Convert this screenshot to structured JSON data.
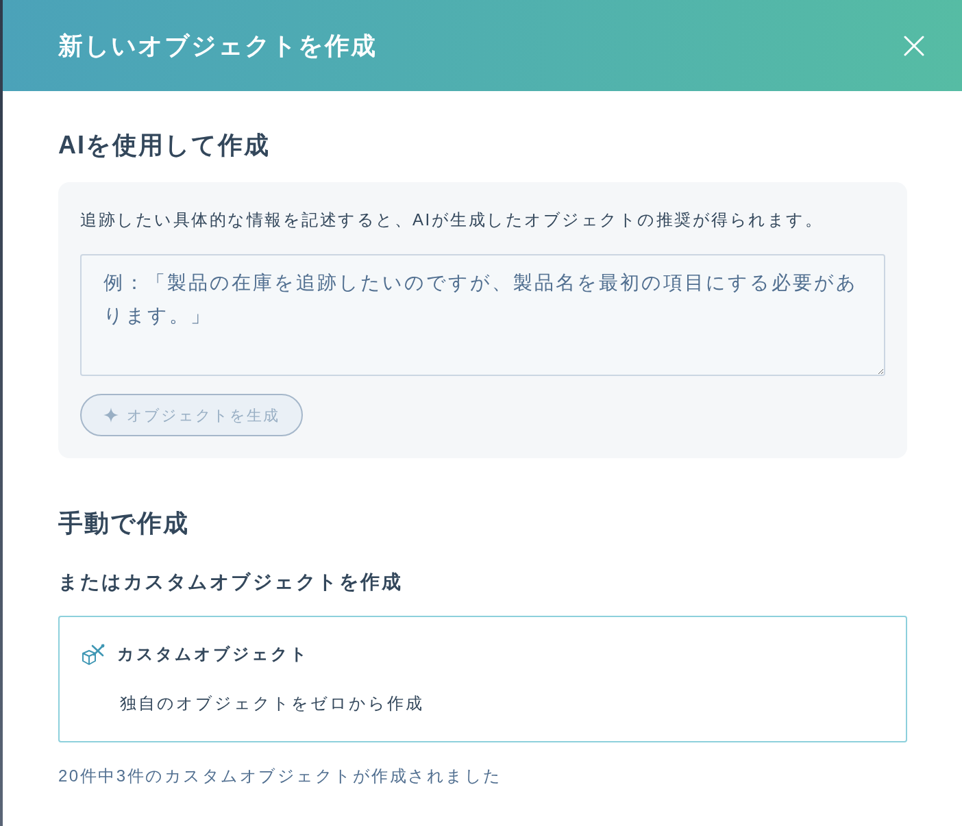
{
  "dialog": {
    "title": "新しいオブジェクトを作成"
  },
  "ai_section": {
    "heading": "AIを使用して作成",
    "description": "追跡したい具体的な情報を記述すると、AIが生成したオブジェクトの推奨が得られます。",
    "prompt_field": {
      "placeholder": "例：「製品の在庫を追跡したいのですが、製品名を最初の項目にする必要があります。」"
    },
    "generate_button": {
      "label": "オブジェクトを生成",
      "disabled": true
    }
  },
  "manual_section": {
    "heading": "手動で作成",
    "subheading": "またはカスタムオブジェクトを作成",
    "options": [
      {
        "kind": "custom",
        "title": "カスタムオブジェクト",
        "description": "独自のオブジェクトをゼロから作成"
      }
    ],
    "usage_note": "20件中3件のカスタムオブジェクトが作成されました"
  }
}
